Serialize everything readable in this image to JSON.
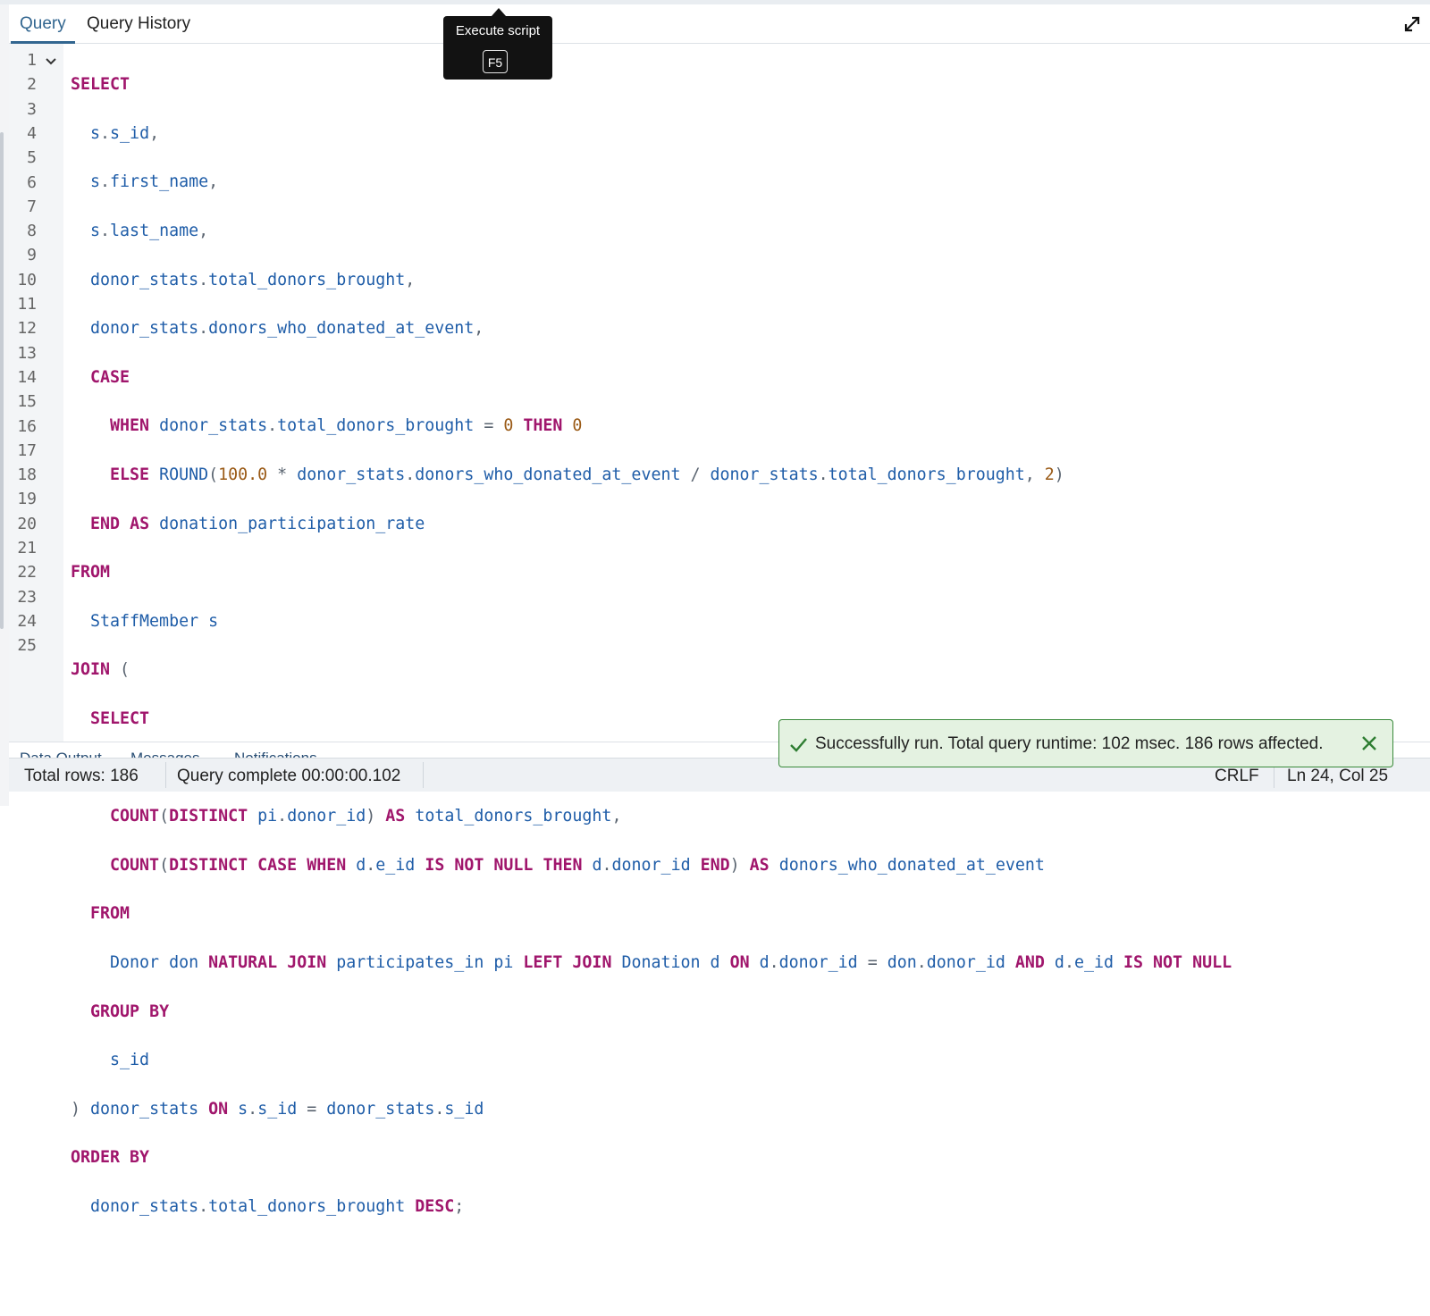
{
  "tabs": {
    "query": "Query",
    "history": "Query History"
  },
  "tooltip": {
    "title": "Execute script",
    "shortcut": "F5"
  },
  "editor": {
    "line_numbers": [
      "1",
      "2",
      "3",
      "4",
      "5",
      "6",
      "7",
      "8",
      "9",
      "10",
      "11",
      "12",
      "13",
      "14",
      "15",
      "16",
      "17",
      "18",
      "19",
      "20",
      "21",
      "22",
      "23",
      "24",
      "25"
    ]
  },
  "lower_tabs": [
    "Data Output",
    "Messages",
    "Notifications"
  ],
  "status": {
    "total_rows": "Total rows: 186",
    "query_complete": "Query complete 00:00:00.102",
    "line_ending": "CRLF",
    "cursor": "Ln 24, Col 25"
  },
  "toast": {
    "message": "Successfully run. Total query runtime: 102 msec. 186 rows affected."
  },
  "colors": {
    "accent": "#326690",
    "keyword": "#a0166c",
    "identifier": "#1f5da8",
    "number": "#9a5a16",
    "success": "#3a8a3b"
  },
  "icons": {
    "expand": "expand-icon",
    "fold": "chevron-down-icon",
    "check": "check-icon",
    "close": "close-icon"
  }
}
